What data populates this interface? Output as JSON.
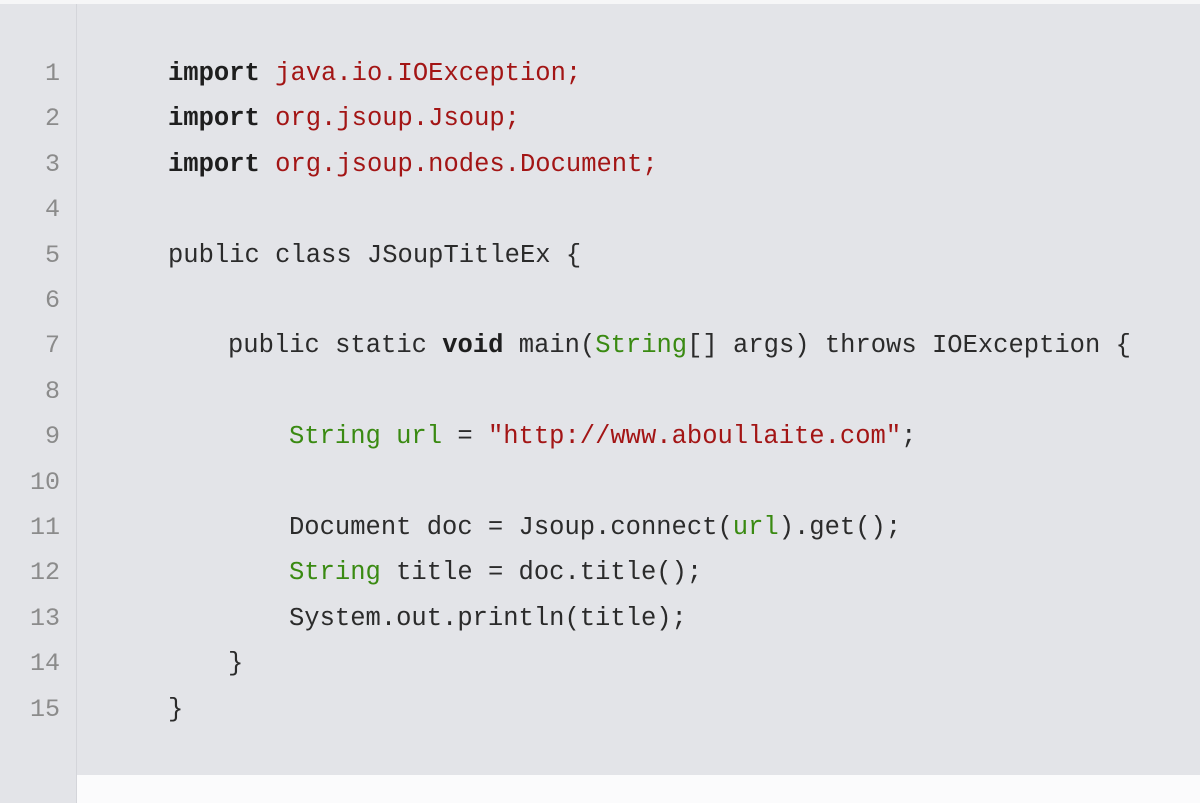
{
  "editor": {
    "lines": [
      {
        "number": "1",
        "tokens": [
          {
            "t": "import",
            "c": "kw"
          },
          {
            "t": " ",
            "c": "plain"
          },
          {
            "t": "java.io.IOException;",
            "c": "pkg"
          }
        ]
      },
      {
        "number": "2",
        "tokens": [
          {
            "t": "import",
            "c": "kw"
          },
          {
            "t": " ",
            "c": "plain"
          },
          {
            "t": "org.jsoup.Jsoup;",
            "c": "pkg"
          }
        ]
      },
      {
        "number": "3",
        "tokens": [
          {
            "t": "import",
            "c": "kw"
          },
          {
            "t": " ",
            "c": "plain"
          },
          {
            "t": "org.jsoup.nodes.Document;",
            "c": "pkg"
          }
        ]
      },
      {
        "number": "4",
        "tokens": []
      },
      {
        "number": "5",
        "tokens": [
          {
            "t": "public class JSoupTitleEx {",
            "c": "plain"
          }
        ]
      },
      {
        "number": "6",
        "tokens": []
      },
      {
        "number": "7",
        "tokens": [
          {
            "t": "public static ",
            "c": "plain"
          },
          {
            "t": "void",
            "c": "kw"
          },
          {
            "t": " main(",
            "c": "plain"
          },
          {
            "t": "String",
            "c": "type"
          },
          {
            "t": "[] args) throws IOException {",
            "c": "plain"
          }
        ]
      },
      {
        "number": "8",
        "tokens": []
      },
      {
        "number": "9",
        "tokens": [
          {
            "t": "String url",
            "c": "type"
          },
          {
            "t": " = ",
            "c": "plain"
          },
          {
            "t": "\"http://www.aboullaite.com\"",
            "c": "str"
          },
          {
            "t": ";",
            "c": "plain"
          }
        ]
      },
      {
        "number": "10",
        "tokens": []
      },
      {
        "number": "11",
        "tokens": [
          {
            "t": "Document doc = Jsoup.connect(",
            "c": "plain"
          },
          {
            "t": "url",
            "c": "type"
          },
          {
            "t": ").get();",
            "c": "plain"
          }
        ]
      },
      {
        "number": "12",
        "tokens": [
          {
            "t": "String",
            "c": "type"
          },
          {
            "t": " title = doc.title();",
            "c": "plain"
          }
        ]
      },
      {
        "number": "13",
        "tokens": [
          {
            "t": "System.out.println(title);",
            "c": "plain"
          }
        ]
      },
      {
        "number": "14",
        "tokens": [
          {
            "t": "}",
            "c": "plain"
          }
        ]
      },
      {
        "number": "15",
        "tokens": [
          {
            "t": "}",
            "c": "plain"
          }
        ]
      }
    ],
    "colors": {
      "background": "#e3e4e8",
      "keyword": "#1e1e1e",
      "string": "#a31515",
      "type": "#3a8a12",
      "line_number": "#8b8b8b"
    }
  }
}
